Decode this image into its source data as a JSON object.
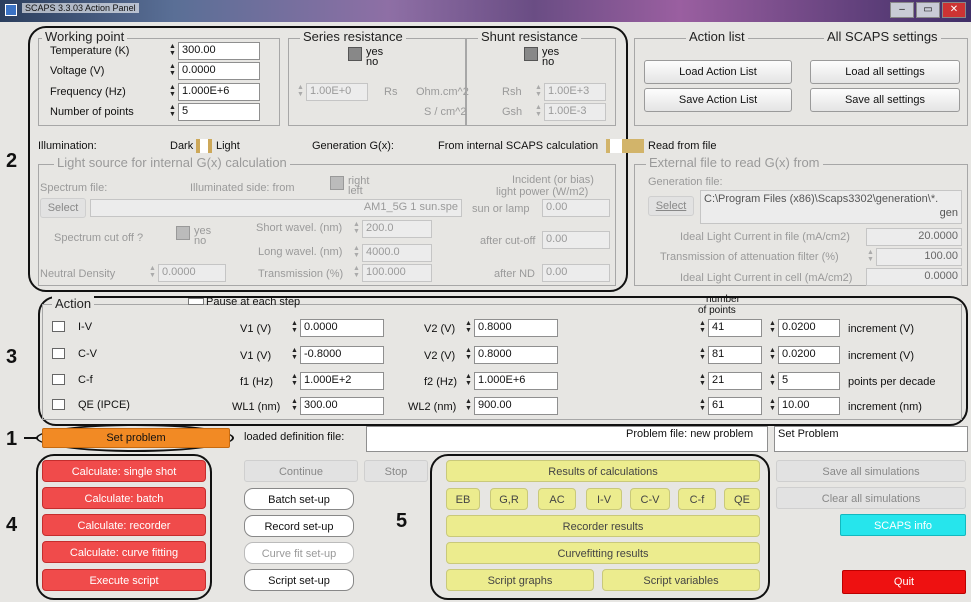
{
  "window": {
    "title": "SCAPS 3.3.03 Action Panel",
    "minimize": "–",
    "maximize": "▭",
    "close": "✕"
  },
  "working_point": {
    "legend": "Working point",
    "rows": [
      {
        "label": "Temperature (K)",
        "value": "300.00"
      },
      {
        "label": "Voltage (V)",
        "value": "0.0000"
      },
      {
        "label": "Frequency (Hz)",
        "value": "1.000E+6"
      },
      {
        "label": "Number of points",
        "value": "5"
      }
    ]
  },
  "series_resistance": {
    "legend": "Series resistance",
    "yes": "yes",
    "no": "no",
    "value": "1.00E+0",
    "label": "Rs",
    "unit1": "Ohm.cm^2",
    "unit2": "S / cm^2"
  },
  "shunt_resistance": {
    "legend": "Shunt resistance",
    "yes": "yes",
    "no": "no",
    "rsh_label": "Rsh",
    "rsh_value": "1.00E+3",
    "gsh_label": "Gsh",
    "gsh_value": "1.00E-3"
  },
  "action_list": {
    "legend": "Action list",
    "load": "Load Action List",
    "save": "Save Action List"
  },
  "all_settings": {
    "legend": "All SCAPS settings",
    "load": "Load all settings",
    "save": "Save all settings"
  },
  "illumination": {
    "label": "Illumination:",
    "dark": "Dark",
    "light": "Light",
    "generation_label": "Generation G(x):",
    "from_internal": "From internal SCAPS calculation",
    "read_from_file": "Read from file"
  },
  "light_source": {
    "legend": "Light source for internal G(x) calculation",
    "spectrum_file": "Spectrum file:",
    "illuminated_side": "Illuminated side: from",
    "right": "right",
    "left": "left",
    "incident": "Incident (or bias)",
    "light_power": "light power (W/m2)",
    "select": "Select",
    "spectrum_name": "AM1_5G 1 sun.spe",
    "sun_or_lamp": "sun or lamp",
    "sun_value": "0.00",
    "cutoff_label": "Spectrum cut off ?",
    "yes": "yes",
    "no": "no",
    "short_wavel": "Short wavel. (nm)",
    "short_value": "200.0",
    "long_wavel": "Long wavel. (nm)",
    "long_value": "4000.0",
    "after_cutoff": "after cut-off",
    "after_cutoff_value": "0.00",
    "neutral_density": "Neutral Density",
    "nd_value": "0.0000",
    "transmission": "Transmission (%)",
    "transmission_value": "100.000",
    "after_nd": "after ND",
    "after_nd_value": "0.00"
  },
  "external_file": {
    "legend": "External file to read G(x) from",
    "generation_file": "Generation file:",
    "select": "Select",
    "path_line1": "C:\\Program Files (x86)\\Scaps3302\\generation\\*.",
    "path_line2": "gen",
    "ideal_light_label": "Ideal Light Current in file (mA/cm2)",
    "ideal_light_value": "20.0000",
    "transmission_label": "Transmission of attenuation filter (%)",
    "transmission_value": "100.00",
    "ideal_cell_label": "Ideal Light Current in cell (mA/cm2)",
    "ideal_cell_value": "0.0000"
  },
  "action": {
    "legend": "Action",
    "pause": "Pause at each step",
    "number_of_points_1": "number",
    "number_of_points_2": "of points",
    "rows": [
      {
        "name": "I-V",
        "p1_label": "V1 (V)",
        "p1": "0.0000",
        "p2_label": "V2 (V)",
        "p2": "0.8000",
        "points": "41",
        "step": "0.0200",
        "unit": "increment (V)"
      },
      {
        "name": "C-V",
        "p1_label": "V1 (V)",
        "p1": "-0.8000",
        "p2_label": "V2 (V)",
        "p2": "0.8000",
        "points": "81",
        "step": "0.0200",
        "unit": "increment (V)"
      },
      {
        "name": "C-f",
        "p1_label": "f1 (Hz)",
        "p1": "1.000E+2",
        "p2_label": "f2 (Hz)",
        "p2": "1.000E+6",
        "points": "21",
        "step": "5",
        "unit": "points per decade"
      },
      {
        "name": "QE (IPCE)",
        "p1_label": "WL1 (nm)",
        "p1": "300.00",
        "p2_label": "WL2 (nm)",
        "p2": "900.00",
        "points": "61",
        "step": "10.00",
        "unit": "increment (nm)"
      }
    ]
  },
  "problem": {
    "set_problem": "Set problem",
    "loaded_label": "loaded definition file:",
    "loaded_value": "",
    "problem_file": "Problem file: new problem",
    "set_problem_box": "Set Problem"
  },
  "calculate": {
    "single": "Calculate: single shot",
    "batch": "Calculate: batch",
    "recorder": "Calculate: recorder",
    "curve": "Calculate: curve fitting",
    "script": "Execute script"
  },
  "setup": {
    "continue": "Continue",
    "stop": "Stop",
    "batch": "Batch set-up",
    "record": "Record set-up",
    "curvefit": "Curve fit set-up",
    "script": "Script set-up"
  },
  "results": {
    "title": "Results of calculations",
    "tabs": [
      "EB",
      "G,R",
      "AC",
      "I-V",
      "C-V",
      "C-f",
      "QE"
    ],
    "recorder": "Recorder results",
    "curvefitting": "Curvefitting results",
    "script_graphs": "Script graphs",
    "script_vars": "Script variables"
  },
  "right_actions": {
    "save_all": "Save all simulations",
    "clear_all": "Clear all simulations",
    "info": "SCAPS info",
    "quit": "Quit"
  },
  "annotations": [
    "1",
    "2",
    "3",
    "4",
    "5"
  ]
}
